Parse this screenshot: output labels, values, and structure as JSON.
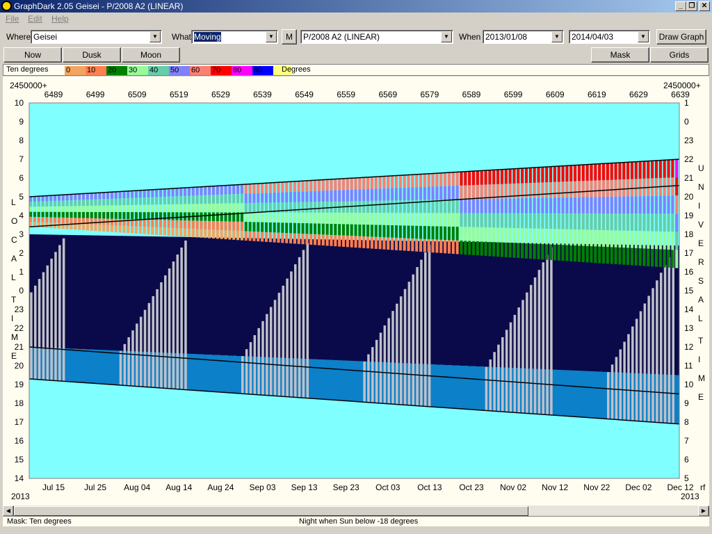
{
  "app": {
    "title": "GraphDark 2.05  Geisei  -  P/2008 A2 (LINEAR)"
  },
  "menu": [
    "File",
    "Edit",
    "Help"
  ],
  "toolbar": {
    "where_label": "Where",
    "where_value": "Geisei",
    "what_label": "What",
    "what_value": "Moving",
    "m_button": "M",
    "object_value": "P/2008 A2 (LINEAR)",
    "when_label": "When",
    "start_date": "2013/01/08",
    "end_date": "2014/04/03",
    "draw_button": "Draw Graph"
  },
  "buttons": {
    "now": "Now",
    "dusk": "Dusk",
    "moon": "Moon",
    "mask": "Mask",
    "grids": "Grids"
  },
  "legend": {
    "title": "Ten degrees",
    "unit": "Degrees",
    "items": [
      {
        "label": "0",
        "color": "#f4a460"
      },
      {
        "label": "10",
        "color": "#ff7f50"
      },
      {
        "label": "20",
        "color": "#008000"
      },
      {
        "label": "30",
        "color": "#98fb98"
      },
      {
        "label": "40",
        "color": "#66cdaa"
      },
      {
        "label": "50",
        "color": "#8080ff"
      },
      {
        "label": "60",
        "color": "#fa8072"
      },
      {
        "label": "70",
        "color": "#ff0000"
      },
      {
        "label": "80",
        "color": "#ff00ff"
      },
      {
        "label": "90",
        "color": "#0000ff"
      }
    ],
    "last_color": "#ffff80"
  },
  "chart_data": {
    "type": "heatmap",
    "jd_prefix_left": "2450000+",
    "jd_prefix_right": "2450000+",
    "jd_ticks": [
      "6489",
      "6499",
      "6509",
      "6519",
      "6529",
      "6539",
      "6549",
      "6559",
      "6569",
      "6579",
      "6589",
      "6599",
      "6609",
      "6619",
      "6629",
      "6639"
    ],
    "date_ticks": [
      "Jul 15",
      "Jul 25",
      "Aug 04",
      "Aug 14",
      "Aug 24",
      "Sep 03",
      "Sep 13",
      "Sep 23",
      "Oct 03",
      "Oct 13",
      "Oct 23",
      "Nov 02",
      "Nov 12",
      "Nov 22",
      "Dec 02",
      "Dec 12"
    ],
    "year_left": "2013",
    "year_right": "2013",
    "right_corner": "rf",
    "local_time_ticks": [
      "10",
      "9",
      "8",
      "7",
      "6",
      "5",
      "4",
      "3",
      "2",
      "1",
      "0",
      "23",
      "22",
      "21",
      "20",
      "19",
      "18",
      "17",
      "16",
      "15",
      "14"
    ],
    "ut_ticks": [
      "1",
      "0",
      "23",
      "22",
      "21",
      "20",
      "19",
      "18",
      "17",
      "16",
      "15",
      "14",
      "13",
      "12",
      "11",
      "10",
      "9",
      "8",
      "7",
      "6",
      "5"
    ],
    "left_axis_title": "LOCAL TIME",
    "right_axis_title": "UNIVERSAL TIME",
    "colors": {
      "sky": "#7fffff",
      "night": "#0a0a4a",
      "twilight": "#0c80c8",
      "moon": "#c0c0c8"
    }
  },
  "status": {
    "mask": "Mask:  Ten degrees",
    "night": "Night when Sun below -18 degrees"
  }
}
